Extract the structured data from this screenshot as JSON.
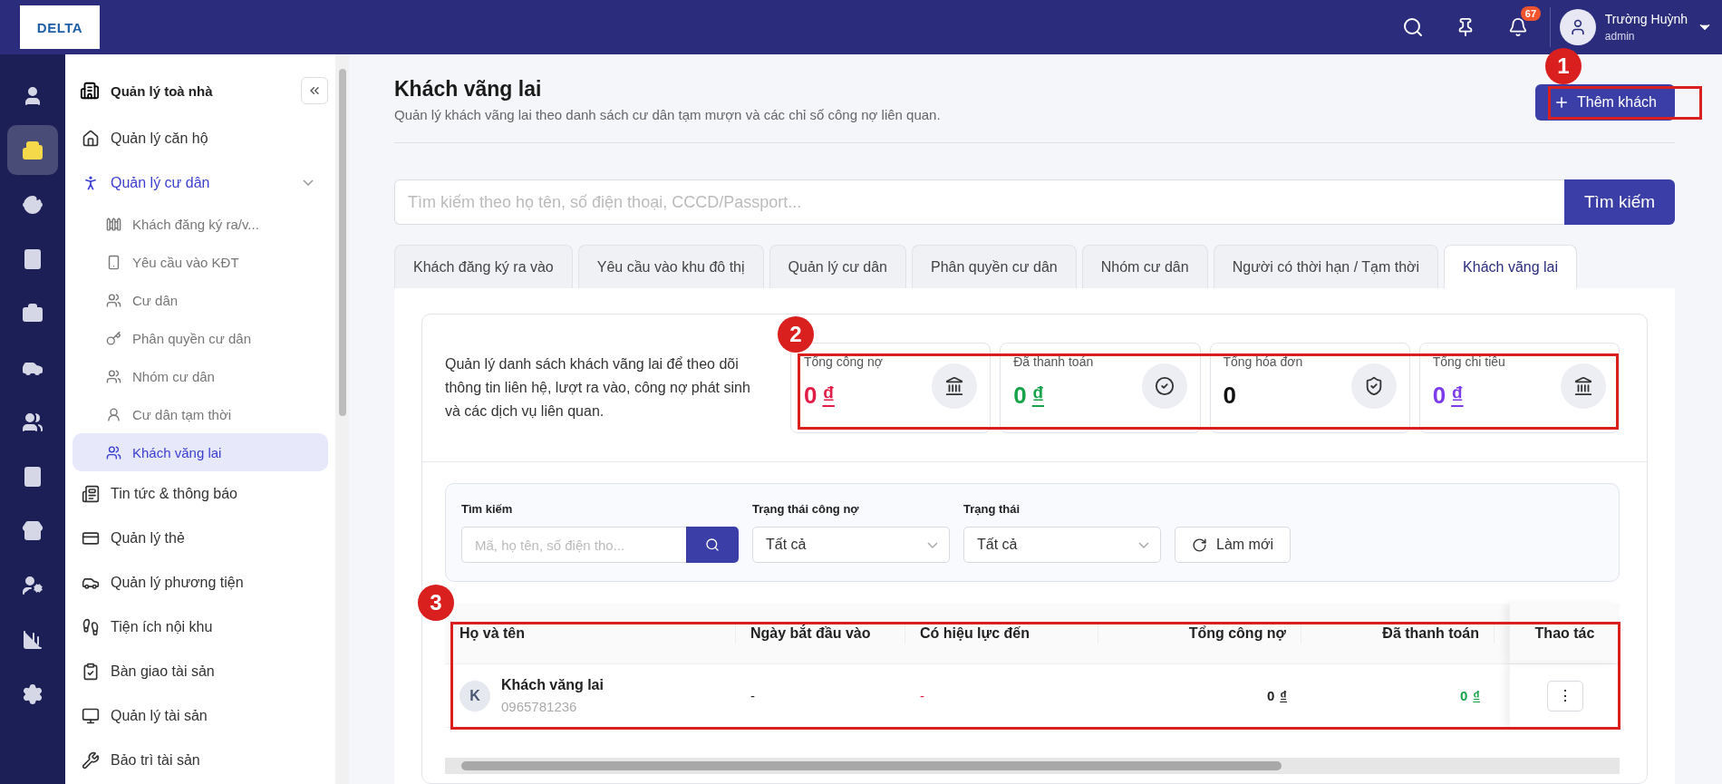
{
  "header": {
    "logo": "DELTA",
    "notification_count": "67",
    "user_name": "Trường Huỳnh",
    "user_role": "admin"
  },
  "rail": [
    {
      "selected": false
    },
    {
      "selected": true
    },
    {
      "selected": false
    },
    {
      "selected": false
    },
    {
      "selected": false
    },
    {
      "selected": false
    },
    {
      "selected": false
    },
    {
      "selected": false
    },
    {
      "selected": false
    },
    {
      "selected": false
    },
    {
      "selected": false
    },
    {
      "selected": false
    }
  ],
  "sidebar": {
    "title": "Quản lý toà nhà",
    "items": [
      {
        "label": "Quản lý căn hộ",
        "selected": false
      },
      {
        "label": "Quản lý cư dân",
        "selected": true,
        "expanded": true,
        "children": [
          {
            "label": "Khách đăng ký ra/v...",
            "selected": false
          },
          {
            "label": "Yêu cầu vào KĐT",
            "selected": false
          },
          {
            "label": "Cư dân",
            "selected": false
          },
          {
            "label": "Phân quyền cư dân",
            "selected": false
          },
          {
            "label": "Nhóm cư dân",
            "selected": false
          },
          {
            "label": "Cư dân tạm thời",
            "selected": false
          },
          {
            "label": "Khách văng lai",
            "selected": true
          }
        ]
      },
      {
        "label": "Tin tức & thông báo",
        "selected": false
      },
      {
        "label": "Quản lý thẻ",
        "selected": false
      },
      {
        "label": "Quản lý phương tiện",
        "selected": false
      },
      {
        "label": "Tiện ích nội khu",
        "selected": false
      },
      {
        "label": "Bàn giao tài sản",
        "selected": false
      },
      {
        "label": "Quản lý tài sản",
        "selected": false
      },
      {
        "label": "Bảo trì tài sản",
        "selected": false
      }
    ]
  },
  "page": {
    "title": "Khách vãng lai",
    "subtitle": "Quản lý khách vãng lai theo danh sách cư dân tạm mượn và các chỉ số công nợ liên quan.",
    "add_button": "Thêm khách"
  },
  "search": {
    "placeholder": "Tìm kiếm theo họ tên, số điện thoại, CCCD/Passport...",
    "button": "Tìm kiếm"
  },
  "tabs": [
    {
      "label": "Khách đăng ký ra vào",
      "selected": false
    },
    {
      "label": "Yêu cầu vào khu đô thị",
      "selected": false
    },
    {
      "label": "Quản lý cư dân",
      "selected": false
    },
    {
      "label": "Phân quyền cư dân",
      "selected": false
    },
    {
      "label": "Nhóm cư dân",
      "selected": false
    },
    {
      "label": "Người có thời hạn / Tạm thời",
      "selected": false
    },
    {
      "label": "Khách vãng lai",
      "selected": true
    }
  ],
  "summary": {
    "description": "Quản lý danh sách khách vãng lai để theo dõi thông tin liên hệ, lượt ra vào, công nợ phát sinh và các dịch vụ liên quan.",
    "stats": [
      {
        "label": "Tổng công nợ",
        "value": "0",
        "currency": "₫",
        "color": "#e11d48",
        "kind": "bank"
      },
      {
        "label": "Đã thanh toán",
        "value": "0",
        "currency": "₫",
        "color": "#16a34a",
        "kind": "check"
      },
      {
        "label": "Tổng hóa đơn",
        "value": "0",
        "color": "#111111",
        "kind": "shield"
      },
      {
        "label": "Tổng chi tiêu",
        "value": "0",
        "currency": "₫",
        "color": "#7c3aed",
        "kind": "bank"
      }
    ]
  },
  "filters": {
    "search_label": "Tìm kiếm",
    "search_placeholder": "Mã, họ tên, số điện tho...",
    "debt_label": "Trạng thái công nợ",
    "debt_value": "Tất cả",
    "status_label": "Trạng thái",
    "status_value": "Tất cả",
    "refresh": "Làm mới"
  },
  "table": {
    "columns": [
      "Họ và tên",
      "Ngày bắt đầu vào",
      "Có hiệu lực đến",
      "Tổng công nợ",
      "Đã thanh toán",
      "Thao tác"
    ],
    "rows": [
      {
        "avatar": "K",
        "name": "Khách văng lai",
        "phone": "0965781236",
        "start": "-",
        "valid_until": "-",
        "debt": "0",
        "debt_currency": "₫",
        "paid": "0",
        "paid_currency": "₫",
        "action": "⋮"
      }
    ]
  },
  "annotations": [
    "1",
    "2",
    "3"
  ]
}
